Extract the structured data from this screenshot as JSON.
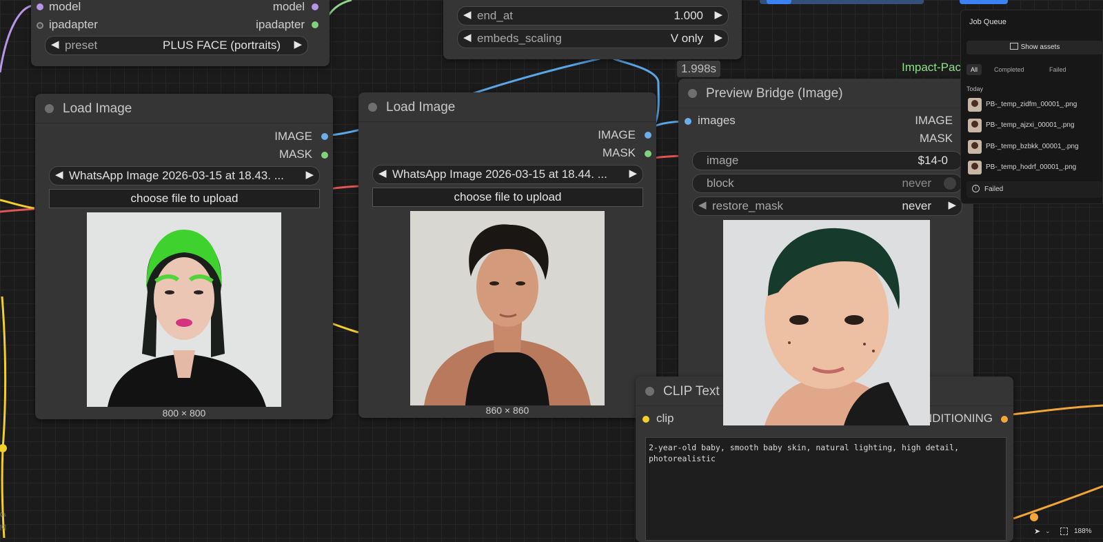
{
  "ipadapter_node": {
    "inputs": [
      "model",
      "ipadapter"
    ],
    "outputs": [
      "model",
      "ipadapter"
    ],
    "preset": {
      "label": "preset",
      "value": "PLUS FACE (portraits)"
    }
  },
  "embeds_node": {
    "end_at": {
      "label": "end_at",
      "value": "1.000"
    },
    "embeds_scaling": {
      "label": "embeds_scaling",
      "value": "V only"
    }
  },
  "timing_badge": "1.998s",
  "impact_badge": "Impact-Pack",
  "load_image_1": {
    "title": "Load Image",
    "outputs": [
      "IMAGE",
      "MASK"
    ],
    "image_value": "WhatsApp Image 2026-03-15 at 18.43. ...",
    "upload_label": "choose file to upload",
    "dims": "800 × 800"
  },
  "load_image_2": {
    "title": "Load Image",
    "outputs": [
      "IMAGE",
      "MASK"
    ],
    "image_value": "WhatsApp Image 2026-03-15 at 18.44. ...",
    "upload_label": "choose file to upload",
    "dims": "860 × 860"
  },
  "preview_bridge": {
    "title": "Preview Bridge (Image)",
    "input": "images",
    "outputs": [
      "IMAGE",
      "MASK"
    ],
    "image": {
      "label": "image",
      "value": "$14-0"
    },
    "block": {
      "label": "block",
      "value": "never"
    },
    "restore_mask": {
      "label": "restore_mask",
      "value": "never"
    }
  },
  "clip_text": {
    "title": "CLIP Text",
    "input": "clip",
    "output": "NDITIONING",
    "prompt": "2-year-old baby, smooth baby skin, natural lighting, high detail,\nphotorealistic"
  },
  "job_queue": {
    "title": "Job Queue",
    "show_assets": "Show assets",
    "tabs": [
      "All",
      "Completed",
      "Failed"
    ],
    "section": "Today",
    "items": [
      "PB-_temp_zidfm_00001_.png",
      "PB-_temp_ajzxi_00001_.png",
      "PB-_temp_bzbkk_00001_.png",
      "PB-_temp_hodrf_00001_.png"
    ],
    "failed_label": "Failed"
  },
  "left_edge": [
    "0s",
    "[0]"
  ],
  "zoom": "188%",
  "colors": {
    "image_socket": "#6aaeea",
    "mask_socket": "#7dd47a",
    "model_socket": "#b796e6",
    "clip_socket": "#f2cf2c",
    "conditioning_socket": "#f2a63a",
    "impact_green": "#8fe08a"
  }
}
